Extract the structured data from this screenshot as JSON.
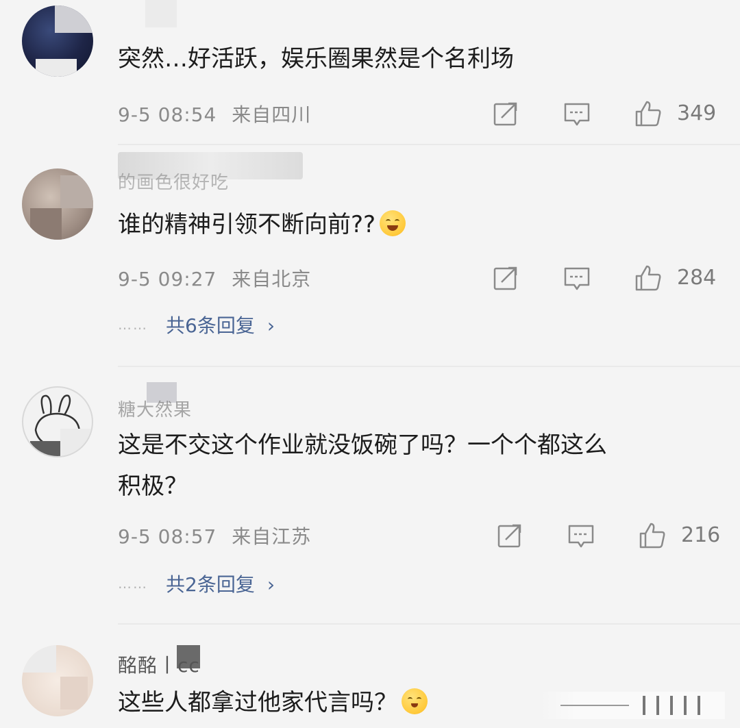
{
  "comments": [
    {
      "text": "突然…好活跃，娱乐圈果然是个名利场",
      "time": "9-5 08:54",
      "location": "来自四川",
      "likes": "349"
    },
    {
      "username": "的画色很好吃",
      "text": "谁的精神引领不断向前??",
      "emoji": "laugh-cry-emoji",
      "time": "9-5 09:27",
      "location": "来自北京",
      "likes": "284",
      "replies": "共6条回复"
    },
    {
      "username": "糖大然果",
      "text_line1": "这是不交这个作业就没饭碗了吗？一个个都这么",
      "text_line2": "积极？",
      "time": "9-5 08:57",
      "location": "来自江苏",
      "likes": "216",
      "replies": "共2条回复"
    },
    {
      "username": "酩酩丨cc",
      "text": "这些人都拿过他家代言吗？",
      "emoji": "shush-emoji"
    }
  ],
  "icons": {
    "repost": "share-icon",
    "comment": "comment-icon",
    "like": "thumbs-up-icon",
    "more": "chevron-right-icon"
  },
  "symbols": {
    "dots": "……",
    "chevron": "›"
  }
}
